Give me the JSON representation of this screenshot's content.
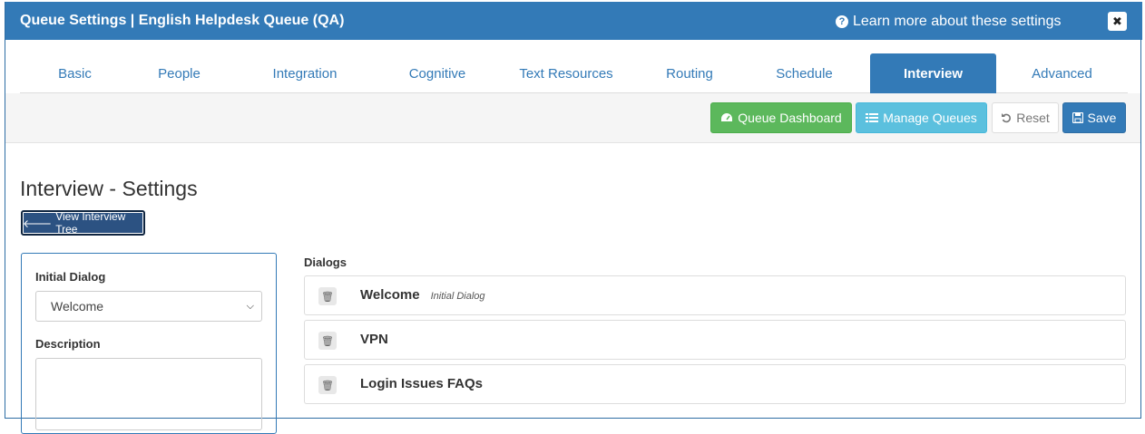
{
  "header": {
    "title": "Queue Settings | English Helpdesk Queue (QA)",
    "learn_more": "Learn more about these settings",
    "close_glyph": "✖"
  },
  "tabs": [
    {
      "label": "Basic"
    },
    {
      "label": "People"
    },
    {
      "label": "Integration"
    },
    {
      "label": "Cognitive"
    },
    {
      "label": "Text Resources"
    },
    {
      "label": "Routing"
    },
    {
      "label": "Schedule"
    },
    {
      "label": "Interview",
      "active": true
    },
    {
      "label": "Advanced"
    }
  ],
  "toolbar": {
    "dashboard": "Queue Dashboard",
    "manage": "Manage Queues",
    "reset": "Reset",
    "save": "Save"
  },
  "page": {
    "heading": "Interview - Settings",
    "view_tree": "View Interview Tree"
  },
  "left": {
    "initial_dialog_label": "Initial Dialog",
    "initial_dialog_value": "Welcome",
    "description_label": "Description"
  },
  "dialogs": {
    "label": "Dialogs",
    "items": [
      {
        "name": "Welcome",
        "tag": "Initial Dialog"
      },
      {
        "name": "VPN",
        "tag": ""
      },
      {
        "name": "Login Issues FAQs",
        "tag": ""
      }
    ]
  },
  "colors": {
    "primary": "#337ab7",
    "success": "#5cb85c",
    "info": "#5bc0de",
    "tree_button": "#2c5282"
  }
}
